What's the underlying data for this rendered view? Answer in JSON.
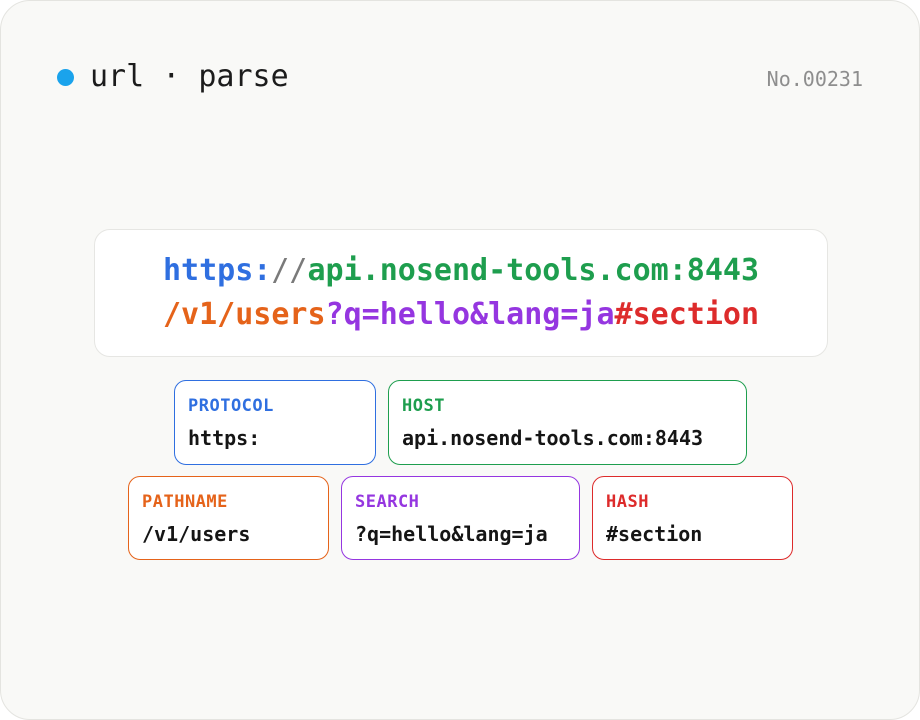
{
  "header": {
    "title": "url · parse",
    "code": "No.00231",
    "dot_color": "#1aa3ec"
  },
  "url": {
    "protocol": "https:",
    "slashes": "//",
    "host": "api.nosend-tools.com:8443",
    "pathname": "/v1/users",
    "search": "?q=hello&lang=ja",
    "hash": "#section"
  },
  "parts": {
    "protocol": {
      "label": "PROTOCOL",
      "value": "https:",
      "color": "#2f6fe0"
    },
    "host": {
      "label": "HOST",
      "value": "api.nosend-tools.com:8443",
      "color": "#1e9e4e"
    },
    "pathname": {
      "label": "PATHNAME",
      "value": "/v1/users",
      "color": "#e5631a"
    },
    "search": {
      "label": "SEARCH",
      "value": "?q=hello&lang=ja",
      "color": "#9536e0"
    },
    "hash": {
      "label": "HASH",
      "value": "#section",
      "color": "#dd2b2b"
    }
  }
}
